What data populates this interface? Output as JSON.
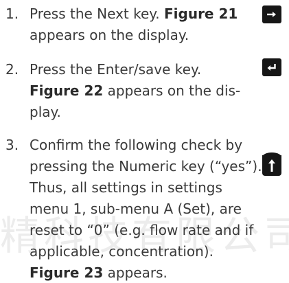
{
  "watermark": "精科技有限公司",
  "steps": [
    {
      "number": "1.",
      "lines": [
        {
          "pre": "Press the Next key. ",
          "bold": "Figure 21",
          "post": ""
        },
        {
          "pre": "appears on the display.",
          "bold": "",
          "post": ""
        }
      ],
      "key_icon": "arrow-right-icon"
    },
    {
      "number": "2.",
      "lines": [
        {
          "pre": "Press the Enter/save key.",
          "bold": "",
          "post": ""
        },
        {
          "pre": "",
          "bold": "Figure 22",
          "post": " appears on the dis-"
        },
        {
          "pre": "play.",
          "bold": "",
          "post": ""
        }
      ],
      "key_icon": "enter-icon"
    },
    {
      "number": "3.",
      "lines": [
        {
          "pre": "Confirm the following check by",
          "bold": "",
          "post": ""
        },
        {
          "pre": "pressing the Numeric key (“yes”).",
          "bold": "",
          "post": ""
        },
        {
          "pre": "Thus, all settings in settings",
          "bold": "",
          "post": ""
        },
        {
          "pre": "menu 1, sub-menu A (Set), are",
          "bold": "",
          "post": ""
        },
        {
          "pre": "reset to “0” (e.g. flow rate and if",
          "bold": "",
          "post": ""
        },
        {
          "pre": "applicable, concentration).",
          "bold": "",
          "post": ""
        },
        {
          "pre": "",
          "bold": "Figure 23",
          "post": " appears."
        }
      ],
      "key_icon": "arrow-up-icon"
    }
  ]
}
